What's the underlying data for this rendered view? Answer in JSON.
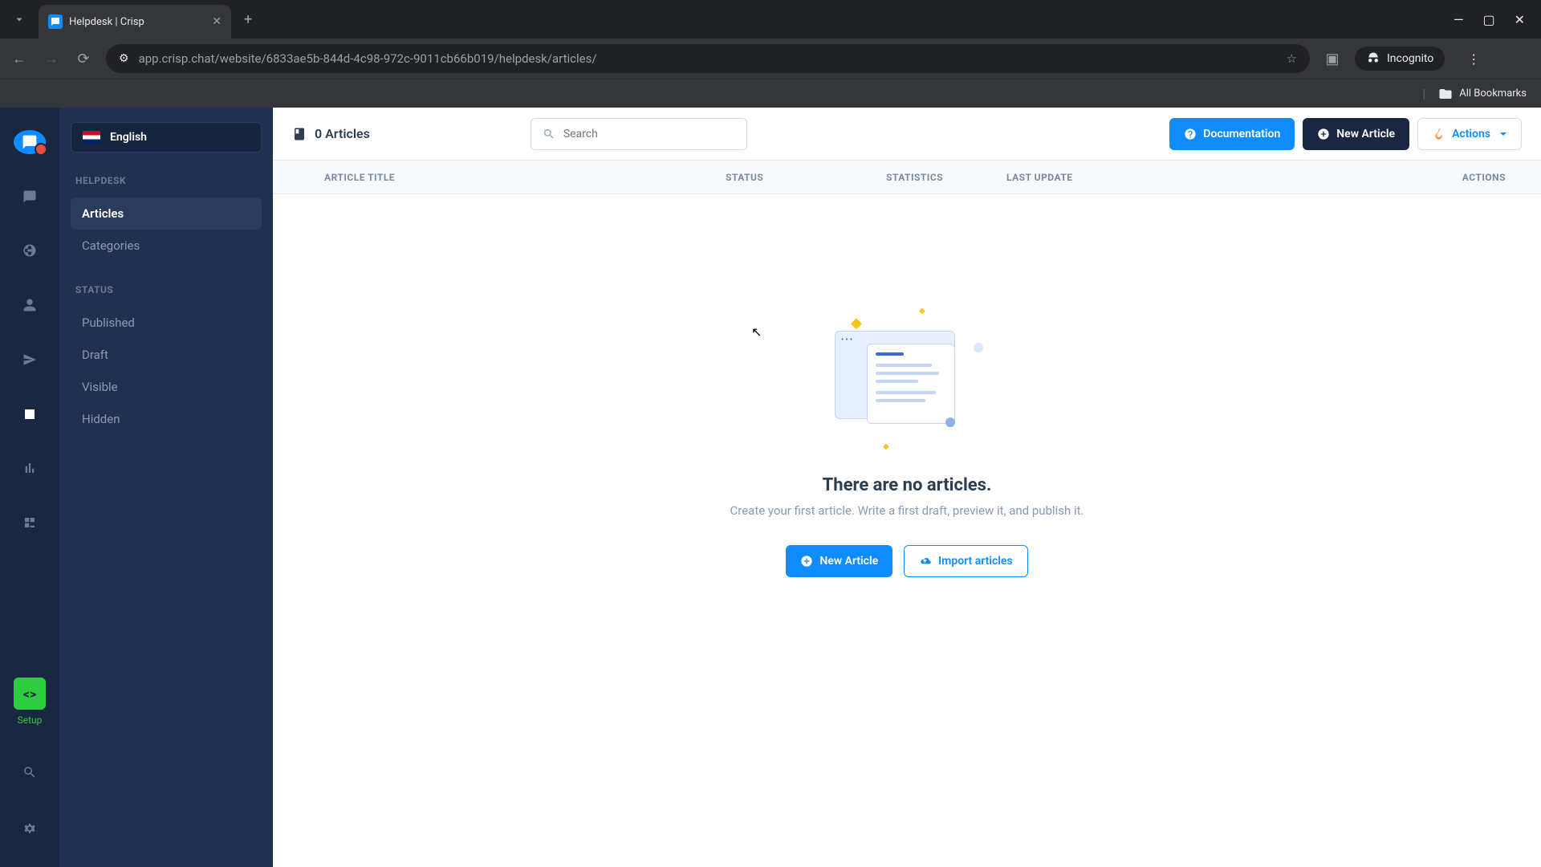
{
  "browser": {
    "tab_title": "Helpdesk | Crisp",
    "url": "app.crisp.chat/website/6833ae5b-844d-4c98-972c-9011cb66b019/helpdesk/articles/",
    "incognito_label": "Incognito",
    "all_bookmarks": "All Bookmarks"
  },
  "rail": {
    "setup_label": "Setup"
  },
  "sidebar": {
    "language": "English",
    "sections": {
      "helpdesk_title": "HELPDESK",
      "status_title": "STATUS"
    },
    "helpdesk_items": [
      "Articles",
      "Categories"
    ],
    "status_items": [
      "Published",
      "Draft",
      "Visible",
      "Hidden"
    ]
  },
  "toolbar": {
    "article_count": "0 Articles",
    "search_placeholder": "Search",
    "documentation_label": "Documentation",
    "new_article_label": "New Article",
    "actions_label": "Actions"
  },
  "table": {
    "columns": {
      "title": "ARTICLE TITLE",
      "status": "STATUS",
      "stats": "STATISTICS",
      "update": "LAST UPDATE",
      "actions": "ACTIONS"
    }
  },
  "empty": {
    "title": "There are no articles.",
    "subtitle": "Create your first article. Write a first draft, preview it, and publish it.",
    "new_article_label": "New Article",
    "import_label": "Import articles"
  }
}
